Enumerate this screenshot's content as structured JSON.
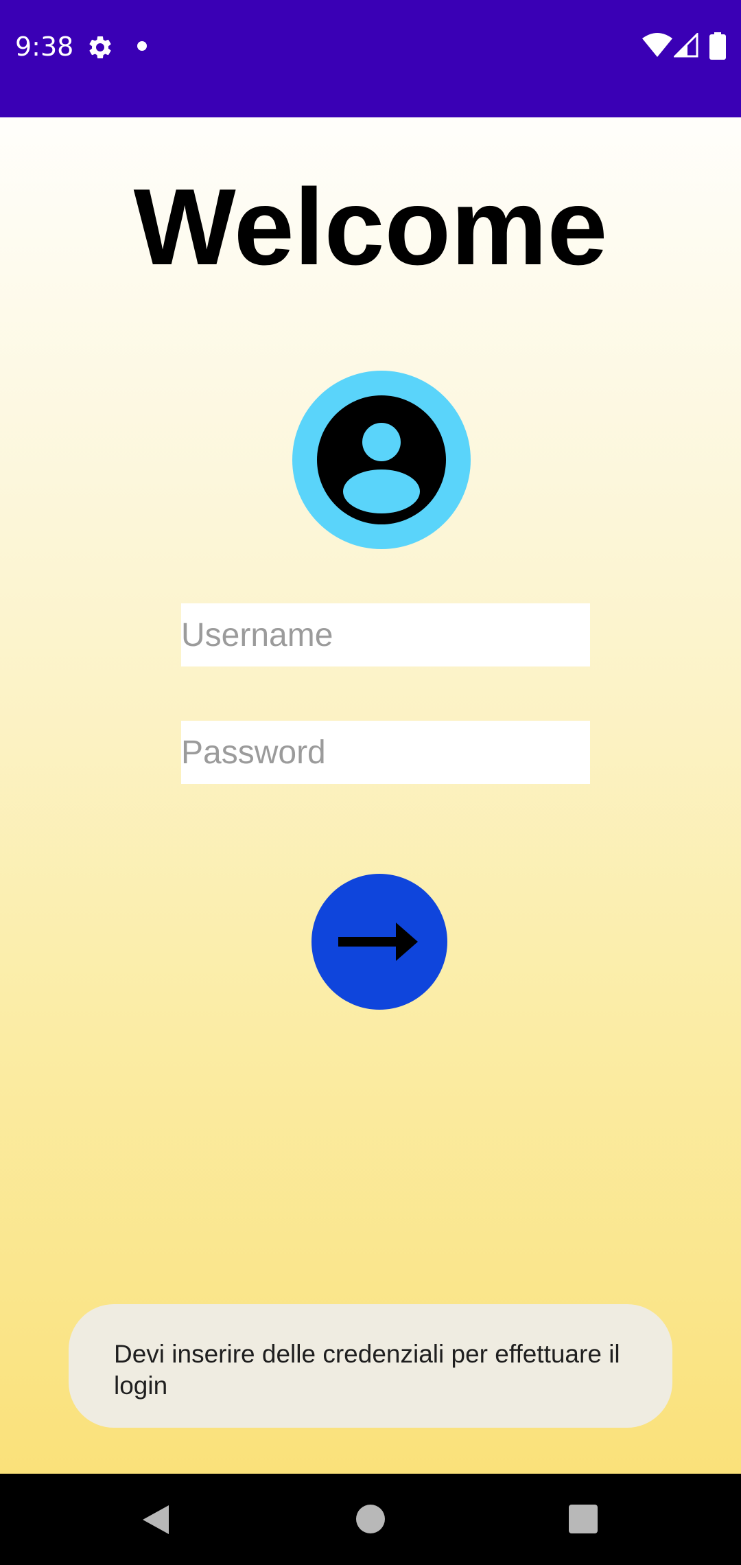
{
  "status_bar": {
    "time": "9:38",
    "icons": [
      "gear-icon",
      "notification-dot-icon",
      "wifi-icon",
      "cell-signal-icon",
      "battery-icon"
    ],
    "background": "#3a00b5"
  },
  "login": {
    "title": "Welcome",
    "avatar_icon": "account-circle-icon",
    "username_placeholder": "Username",
    "username_value": "",
    "password_placeholder": "Password",
    "password_value": "",
    "submit_icon": "arrow-right-icon",
    "colors": {
      "avatar_ring": "#5ad4fa",
      "submit_button": "#0f45dc",
      "gradient_top": "#fffefb",
      "gradient_bottom": "#fae17a"
    }
  },
  "toast": {
    "message": "Devi inserire delle credenziali per effettuare il login",
    "background": "#efece1"
  },
  "nav_bar": {
    "icons": [
      "back-icon",
      "home-icon",
      "recents-icon"
    ]
  }
}
